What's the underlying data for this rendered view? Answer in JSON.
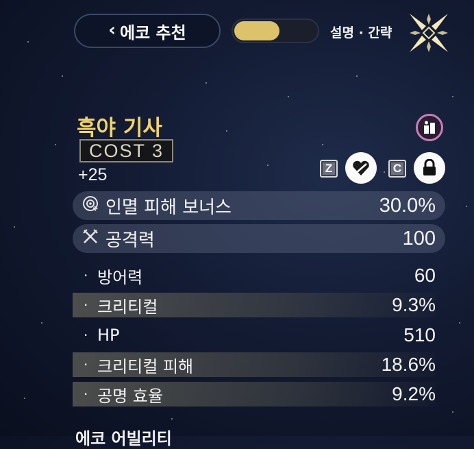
{
  "header": {
    "back_label": "에코 추천",
    "toggle_on": true,
    "mode_label": "설명 · 간략"
  },
  "echo": {
    "name": "흑야 기사",
    "cost": "COST  3",
    "level": "+25"
  },
  "hotkeys": {
    "discard_key": "Z",
    "lock_key": "C"
  },
  "main_stats": [
    {
      "name": "인멸 피해 보너스",
      "value": "30.0%",
      "icon": "havoc-damage-icon"
    },
    {
      "name": "공격력",
      "value": "100",
      "icon": "attack-crossed-swords-icon"
    }
  ],
  "sub_stats": [
    {
      "name": "방어력",
      "value": "60",
      "shaded": false
    },
    {
      "name": "크리티컬",
      "value": "9.3%",
      "shaded": true
    },
    {
      "name": "HP",
      "value": "510",
      "shaded": false
    },
    {
      "name": "크리티컬 피해",
      "value": "18.6%",
      "shaded": true
    },
    {
      "name": "공명 효율",
      "value": "9.2%",
      "shaded": true
    }
  ],
  "section_title": "에코 어빌리티",
  "colors": {
    "accent_gold": "#f3d36a",
    "toggle_knob": "#dcc36b",
    "set_icon_border": "#c77fb5",
    "background": "#131b33"
  }
}
